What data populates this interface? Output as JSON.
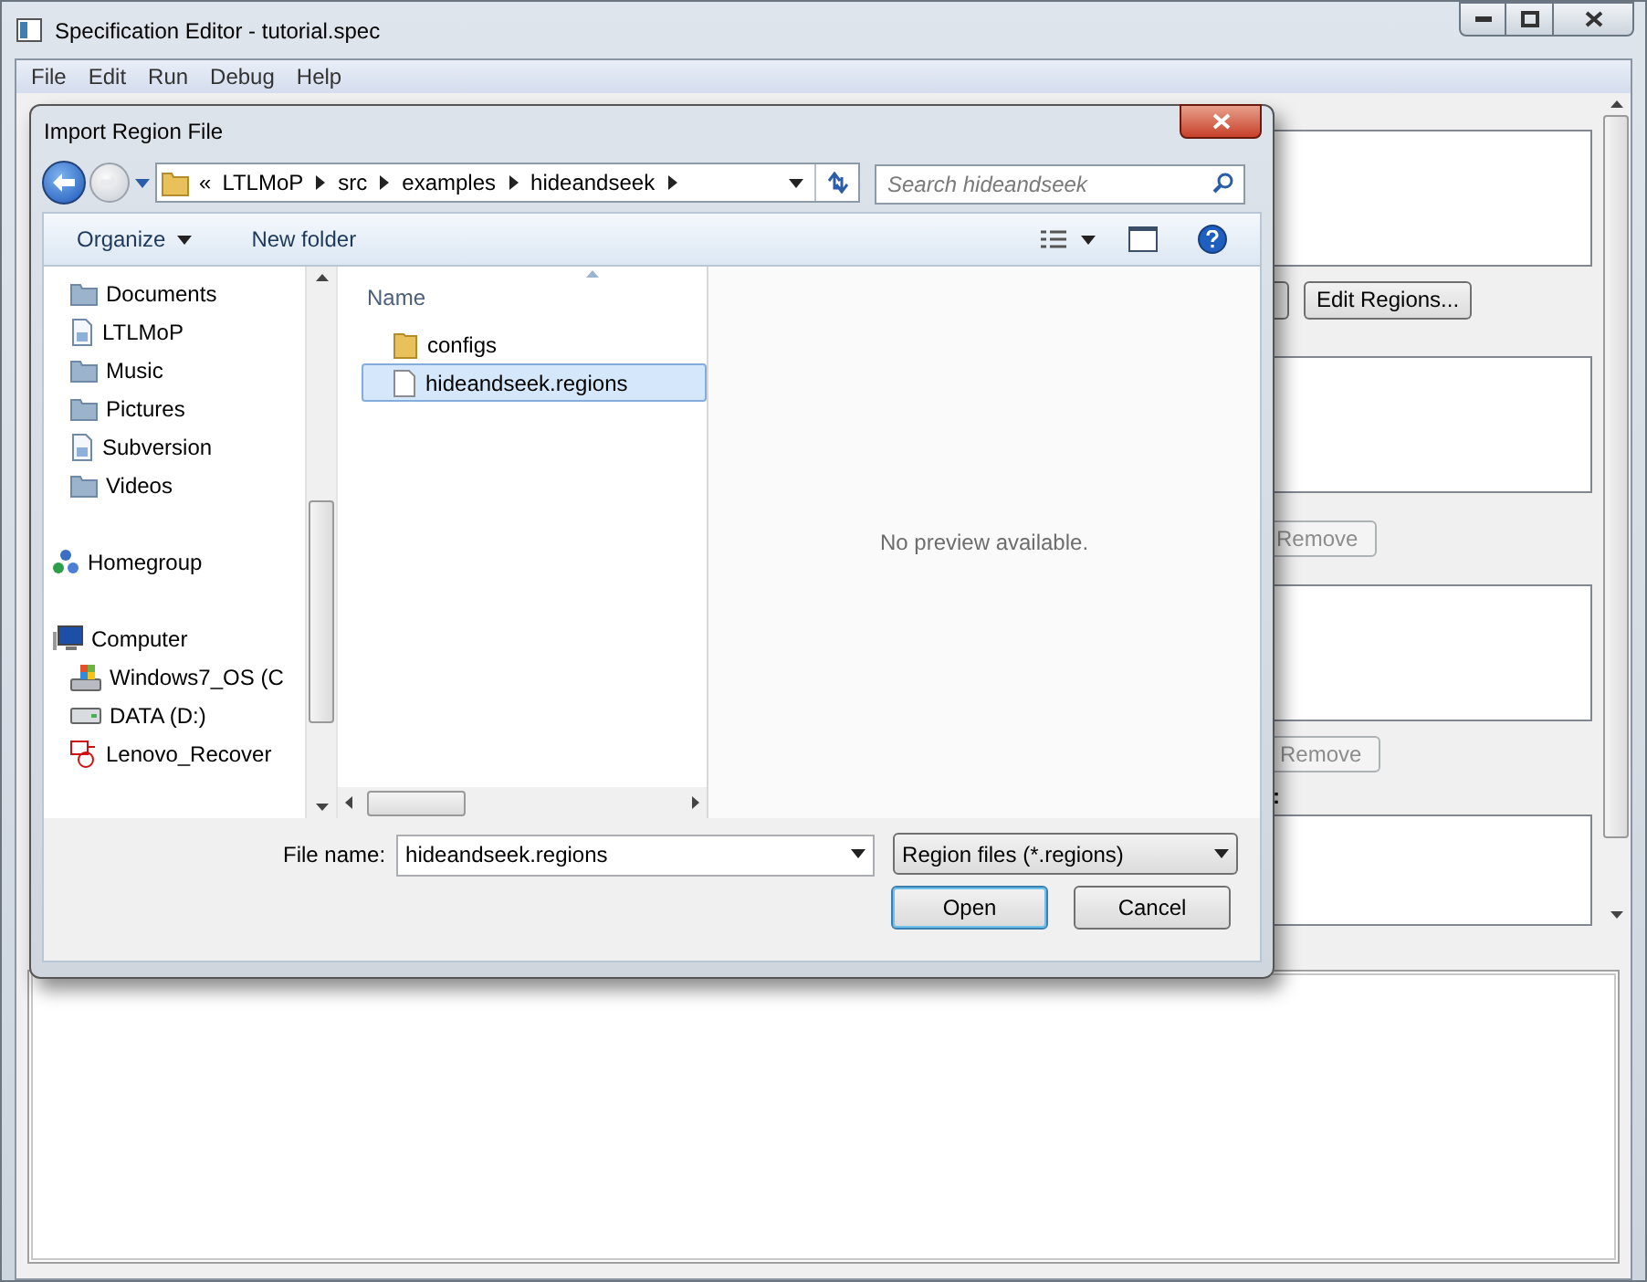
{
  "window": {
    "title": "Specification Editor - tutorial.spec"
  },
  "menu": [
    "File",
    "Edit",
    "Run",
    "Debug",
    "Help"
  ],
  "right_panel": {
    "edit_regions_button": "Edit Regions...",
    "remove_buttons": [
      {
        "label": "Remove",
        "disabled": true
      },
      {
        "label": "Remove",
        "disabled": true
      }
    ],
    "label_fragment": ":"
  },
  "dialog": {
    "title": "Import Region File",
    "breadcrumb_prefix": "«",
    "breadcrumb": [
      "LTLMoP",
      "src",
      "examples",
      "hideandseek"
    ],
    "search": {
      "placeholder": "Search hideandseek"
    },
    "toolbar": {
      "organize": "Organize",
      "new_folder": "New folder"
    },
    "nav_items": [
      {
        "label": "Documents",
        "kind": "folder"
      },
      {
        "label": "LTLMoP",
        "kind": "shortcut"
      },
      {
        "label": "Music",
        "kind": "folder"
      },
      {
        "label": "Pictures",
        "kind": "folder"
      },
      {
        "label": "Subversion",
        "kind": "shortcut"
      },
      {
        "label": "Videos",
        "kind": "folder"
      },
      {
        "label": "Homegroup",
        "kind": "homegroup"
      },
      {
        "label": "Computer",
        "kind": "computer"
      },
      {
        "label": "Windows7_OS (C",
        "kind": "os-drive"
      },
      {
        "label": "DATA (D:)",
        "kind": "drive"
      },
      {
        "label": "Lenovo_Recover",
        "kind": "recovery-drive"
      }
    ],
    "files_header": "Name",
    "files": [
      {
        "name": "configs",
        "kind": "folder",
        "selected": false
      },
      {
        "name": "hideandseek.regions",
        "kind": "file",
        "selected": true
      }
    ],
    "preview": "No preview available.",
    "file_name_label": "File name:",
    "file_name_value": "hideandseek.regions",
    "filter": "Region files (*.regions)",
    "buttons": [
      {
        "label": "Open",
        "default": true
      },
      {
        "label": "Cancel",
        "default": false
      }
    ]
  }
}
